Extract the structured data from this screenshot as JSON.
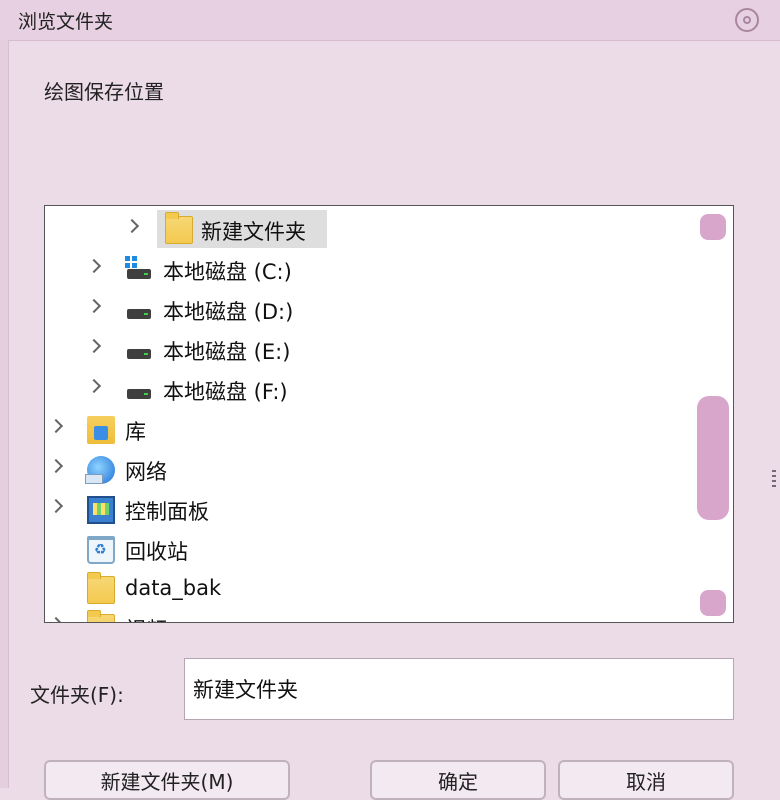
{
  "window": {
    "title": "浏览文件夹"
  },
  "description": "绘图保存位置",
  "tree": {
    "items": [
      {
        "label": "新建文件夹",
        "icon": "folder-icon",
        "expandable": true,
        "selected": true
      },
      {
        "label": "本地磁盘 (C:)",
        "icon": "system-drive-icon",
        "expandable": true
      },
      {
        "label": "本地磁盘 (D:)",
        "icon": "drive-icon",
        "expandable": true
      },
      {
        "label": "本地磁盘 (E:)",
        "icon": "drive-icon",
        "expandable": true
      },
      {
        "label": "本地磁盘 (F:)",
        "icon": "drive-icon",
        "expandable": true
      },
      {
        "label": "库",
        "icon": "library-icon",
        "expandable": true
      },
      {
        "label": "网络",
        "icon": "network-icon",
        "expandable": true
      },
      {
        "label": "控制面板",
        "icon": "control-panel-icon",
        "expandable": true
      },
      {
        "label": "回收站",
        "icon": "recycle-bin-icon",
        "expandable": false
      },
      {
        "label": "data_bak",
        "icon": "folder-icon",
        "expandable": false
      },
      {
        "label": "视频",
        "icon": "folder-icon",
        "expandable": true
      }
    ]
  },
  "folder_field": {
    "label": "文件夹(F):",
    "value": "新建文件夹"
  },
  "buttons": {
    "new_folder": "新建文件夹(M)",
    "ok": "确定",
    "cancel": "取消"
  }
}
